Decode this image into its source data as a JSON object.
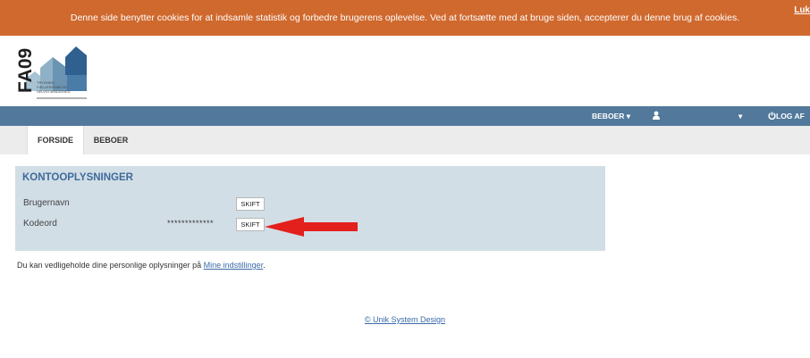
{
  "cookie_banner": {
    "text": "Denne side benytter cookies for at indsamle statistik og forbedre brugerens oplevelse. Ved at fortsætte med at bruge siden, accepterer du denne brug af cookies.",
    "close_label": "Luk"
  },
  "logo": {
    "brand": "FA09",
    "tagline": [
      "TRYGHED,",
      "FÆLLESSKAB OG",
      "SELVSTÆNDIGHED"
    ]
  },
  "navbar": {
    "beboer_label": "BEBOER ▾",
    "user_icon": "user-icon",
    "dropdown_caret": "▾",
    "logout_label": "LOG AF"
  },
  "tabs": [
    {
      "label": "FORSIDE",
      "active": true
    },
    {
      "label": "BEBOER",
      "active": false
    }
  ],
  "account": {
    "title": "KONTOOPLYSNINGER",
    "rows": [
      {
        "label": "Brugernavn",
        "value": "",
        "button": "SKIFT"
      },
      {
        "label": "Kodeord",
        "value": "*************",
        "button": "SKIFT"
      }
    ]
  },
  "info": {
    "text": "Du kan vedligeholde dine personlige oplysninger på ",
    "link": "Mine indstillinger",
    "suffix": "."
  },
  "footer": {
    "link": "© Unik System Design"
  },
  "colors": {
    "cookie_bar": "#d0692e",
    "navbar": "#52799b",
    "panel": "#d2dee6",
    "title": "#3e6a9a",
    "arrow": "#e3201c"
  }
}
